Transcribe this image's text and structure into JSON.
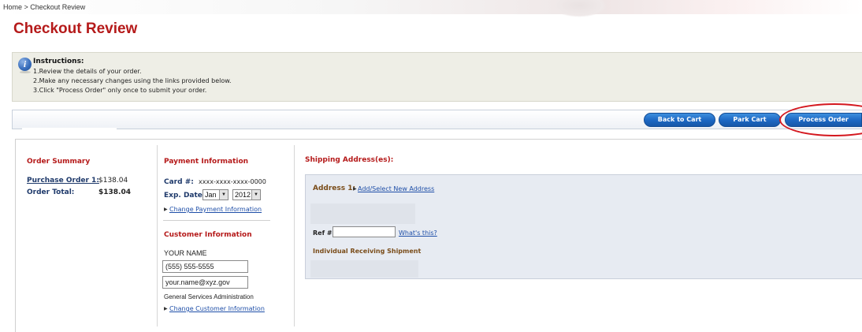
{
  "breadcrumb": "Home > Checkout Review",
  "page_title": "Checkout Review",
  "instructions": {
    "title": "Instructions:",
    "steps": [
      "1.Review the details of your order.",
      "2.Make any necessary changes using the links provided below.",
      "3.Click \"Process Order\" only once to submit your order."
    ]
  },
  "toolbar": {
    "back_label": "Back to Cart",
    "park_label": "Park Cart",
    "process_label": "Process Order"
  },
  "order_summary": {
    "title": "Order Summary",
    "purchase_label": "Purchase Order 1:",
    "purchase_value": "$138.04",
    "total_label": "Order Total:",
    "total_value": "$138.04"
  },
  "payment": {
    "title": "Payment Information",
    "card_label": "Card #:",
    "card_value": "xxxx-xxxx-xxxx-0000",
    "exp_label": "Exp. Date:",
    "exp_month": "Jan",
    "exp_year": "2012",
    "change_link": "Change Payment Information"
  },
  "customer": {
    "title": "Customer Information",
    "name": "YOUR NAME",
    "phone": "(555) 555-5555",
    "email": "your.name@xyz.gov",
    "agency": "General Services Administration",
    "change_link": "Change Customer Information"
  },
  "shipping": {
    "title": "Shipping Address(es):",
    "address_label": "Address 1:",
    "add_link": "Add/Select New Address",
    "ref_label": "Ref #",
    "whats_this": "What's this?",
    "receiving_label": "Individual Receiving Shipment"
  },
  "colors": {
    "accent_red": "#b51a1a",
    "button_blue": "#1c67c2",
    "highlight_circle": "#d4181f"
  }
}
